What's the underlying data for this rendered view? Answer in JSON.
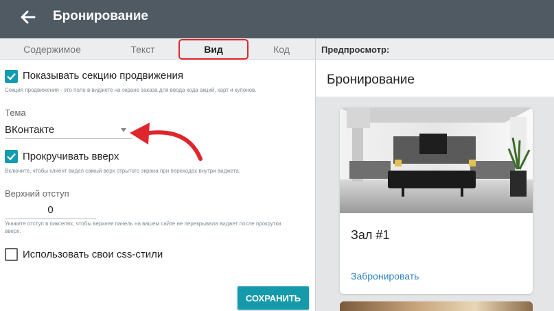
{
  "header": {
    "title": "Бронирование",
    "back_icon": "arrow-left-icon"
  },
  "tabs": [
    {
      "label": "Содержимое",
      "active": false
    },
    {
      "label": "Текст",
      "active": false
    },
    {
      "label": "Вид",
      "active": true
    },
    {
      "label": "Код",
      "active": false
    }
  ],
  "preview_label": "Предпросмотр:",
  "settings": {
    "promo": {
      "checked": true,
      "label": "Показывать секцию продвижения",
      "hint": "Секция продвижения - это поле в виджете на экране заказа для ввода кода акций, карт и купонов."
    },
    "theme": {
      "label": "Тема",
      "value": "ВКонтакте"
    },
    "scroll": {
      "checked": true,
      "label": "Прокручивать вверх",
      "hint": "Включите, чтобы клиент видел самый верх отрытого экрана при переходах внутри виджета."
    },
    "offset": {
      "label": "Верхний отступ",
      "value": "0",
      "hint": "Укажите отступ в пикселях, чтобы верхняя панель на вашем сайте не перекрывала виджет после прокрутки вверх."
    },
    "custom_css": {
      "checked": false,
      "label": "Использовать свои css-стили"
    },
    "save_label": "СОХРАНИТЬ"
  },
  "preview": {
    "title": "Бронирование",
    "card": {
      "title": "Зал #1",
      "link": "Забронировать"
    }
  },
  "colors": {
    "topbar": "#4f5a63",
    "accent": "#139bb0",
    "save_button": "#149aaa",
    "annotation": "#e0262d",
    "link": "#2f80c0"
  }
}
